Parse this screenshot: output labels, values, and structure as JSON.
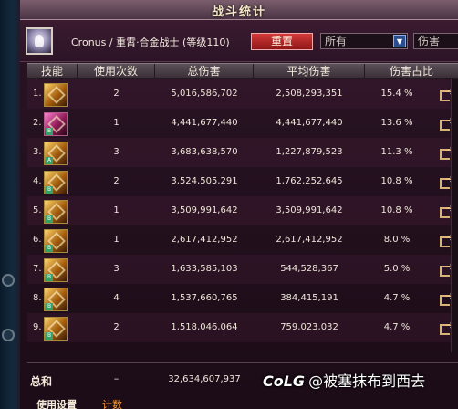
{
  "window": {
    "title": "战斗统计"
  },
  "header": {
    "character": "Cronus / 重霄·合金战士 (等级110)",
    "reset_label": "重置",
    "filter1": "所有",
    "filter2": "伤害"
  },
  "columns": [
    "技能",
    "使用次数",
    "总伤害",
    "平均伤害",
    "伤害占比"
  ],
  "rows": [
    {
      "index": "1.",
      "uses": "2",
      "total": "5,016,586,702",
      "avg": "2,508,293,351",
      "pct": "15.4 %"
    },
    {
      "index": "2.",
      "uses": "1",
      "total": "4,441,677,440",
      "avg": "4,441,677,440",
      "pct": "13.6 %"
    },
    {
      "index": "3.",
      "uses": "3",
      "total": "3,683,638,570",
      "avg": "1,227,879,523",
      "pct": "11.3 %"
    },
    {
      "index": "4.",
      "uses": "2",
      "total": "3,524,505,291",
      "avg": "1,762,252,645",
      "pct": "10.8 %"
    },
    {
      "index": "5.",
      "uses": "1",
      "total": "3,509,991,642",
      "avg": "3,509,991,642",
      "pct": "10.8 %"
    },
    {
      "index": "6.",
      "uses": "1",
      "total": "2,617,412,952",
      "avg": "2,617,412,952",
      "pct": "8.0 %"
    },
    {
      "index": "7.",
      "uses": "3",
      "total": "1,633,585,103",
      "avg": "544,528,367",
      "pct": "5.0 %"
    },
    {
      "index": "8.",
      "uses": "4",
      "total": "1,537,660,765",
      "avg": "384,415,191",
      "pct": "4.7 %"
    },
    {
      "index": "9.",
      "uses": "2",
      "total": "1,518,046,064",
      "avg": "759,023,032",
      "pct": "4.7 %"
    }
  ],
  "totals": {
    "label": "总和",
    "uses": "–",
    "damage": "32,634,607,937"
  },
  "footer": {
    "settings_label": "使用设置",
    "count_label": "计数"
  },
  "watermark": {
    "logo": "CoLG",
    "text": "@被塞抹布到西去"
  }
}
